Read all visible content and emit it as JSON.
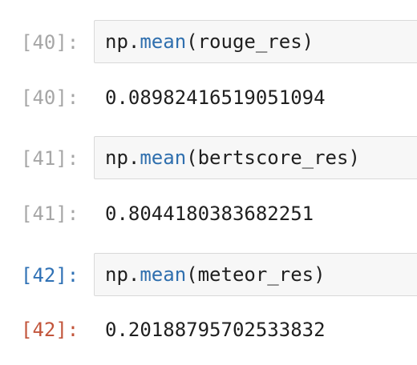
{
  "cells": [
    {
      "in_prompt": "[40]:",
      "code": {
        "obj": "np.",
        "fn": "mean",
        "args": "(rouge_res)"
      },
      "out_prompt": "[40]:",
      "output": "0.08982416519051094"
    },
    {
      "in_prompt": "[41]:",
      "code": {
        "obj": "np.",
        "fn": "mean",
        "args": "(bertscore_res)"
      },
      "out_prompt": "[41]:",
      "output": "0.8044180383682251"
    },
    {
      "in_prompt": "[42]:",
      "code": {
        "obj": "np.",
        "fn": "mean",
        "args": "(meteor_res)"
      },
      "out_prompt": "[42]:",
      "output": "0.20188795702533832"
    }
  ],
  "colors": {
    "prompt_inactive": "#a6a6a6",
    "prompt_in_active": "#2f71b5",
    "prompt_out_active": "#c2553b",
    "input_background": "#f7f7f7",
    "function_name": "#2f6fae"
  }
}
